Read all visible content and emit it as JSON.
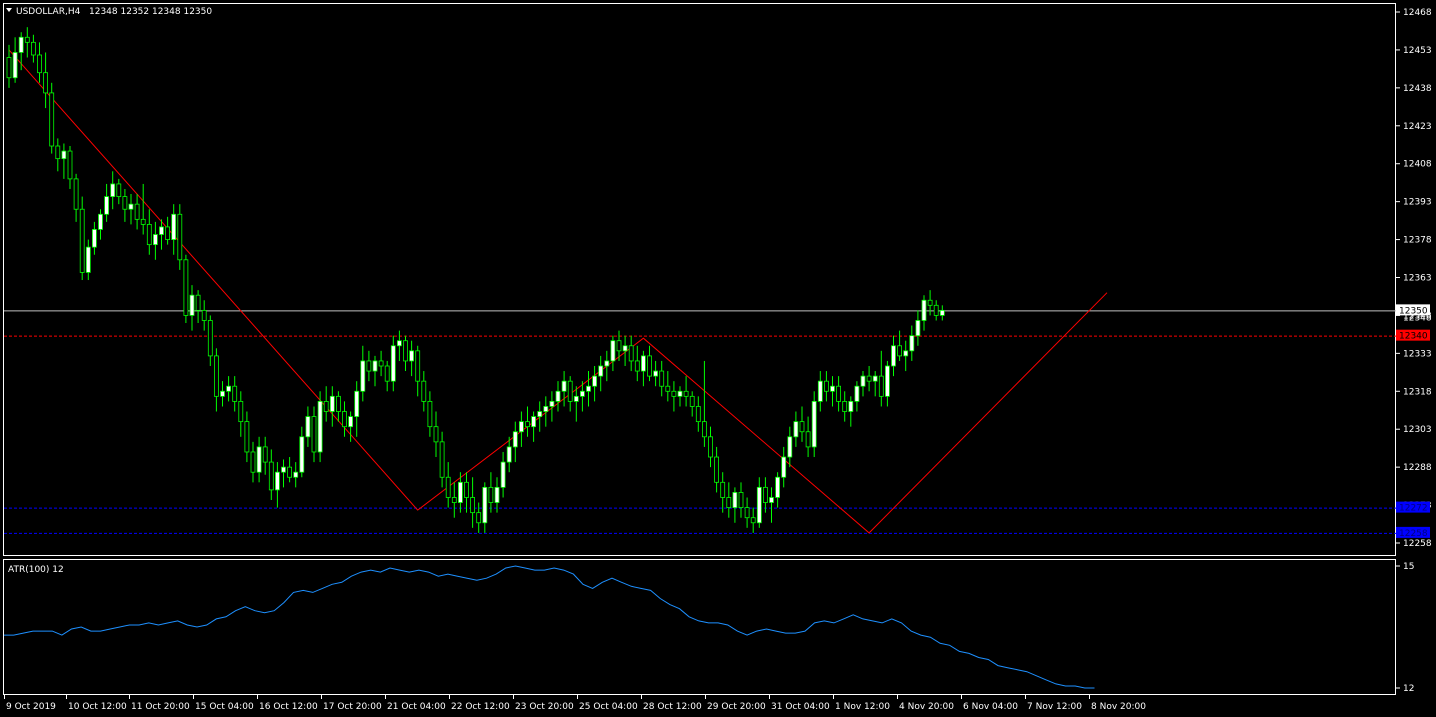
{
  "chart_header": {
    "symbol_timeframe": "USDOLLAR,H4",
    "ohlc": "12348 12352 12348 12350"
  },
  "indicator_header": {
    "label": "ATR(100) 12"
  },
  "colors": {
    "background": "#000000",
    "frame": "#ffffff",
    "bull_body": "#ffffff",
    "bear_body": "#000000",
    "wick": "#00ff00",
    "zigzag": "#ff0000",
    "atr_line": "#1e90ff",
    "bid_line": "#c0c0c0",
    "level_red": "#ff0000",
    "level_blue": "#0000ff"
  },
  "chart_data": {
    "type": "candlestick",
    "title": "USDOLLAR,H4",
    "price_axis_ticks": [
      "12468",
      "12453",
      "12438",
      "12423",
      "12408",
      "12393",
      "12378",
      "12363",
      "12348",
      "12333",
      "12318",
      "12303",
      "12288",
      "12273",
      "12258"
    ],
    "time_axis_ticks": [
      "9 Oct 2019",
      "10 Oct 12:00",
      "11 Oct 20:00",
      "15 Oct 04:00",
      "16 Oct 12:00",
      "17 Oct 20:00",
      "21 Oct 04:00",
      "22 Oct 12:00",
      "23 Oct 20:00",
      "25 Oct 04:00",
      "28 Oct 12:00",
      "29 Oct 20:00",
      "31 Oct 04:00",
      "1 Nov 12:00",
      "4 Nov 20:00",
      "6 Nov 04:00",
      "7 Nov 12:00",
      "8 Nov 20:00"
    ],
    "ylim": [
      12256,
      12470
    ],
    "current_price": 12350,
    "price_labels": {
      "current": "12350",
      "behind_current": "12348",
      "red_level": "12340",
      "blue_upper": "12272",
      "blue_lower": "12258"
    },
    "levels": [
      {
        "value": 12350,
        "style": "solid",
        "color": "#c0c0c0"
      },
      {
        "value": 12340,
        "style": "dashed",
        "color": "#ff0000"
      },
      {
        "value": 12272,
        "style": "dashed",
        "color": "#0000ff"
      },
      {
        "value": 12262,
        "style": "dashed",
        "color": "#0000ff"
      }
    ],
    "zigzag": [
      {
        "bar": 0,
        "price": 12453
      },
      {
        "bar": 67,
        "price": 12271
      },
      {
        "bar": 104,
        "price": 12339
      },
      {
        "bar": 141,
        "price": 12262
      },
      {
        "bar": 180,
        "price": 12357
      }
    ],
    "candles": [
      [
        12450,
        12455,
        12438,
        12442
      ],
      [
        12442,
        12458,
        12440,
        12452
      ],
      [
        12452,
        12460,
        12445,
        12458
      ],
      [
        12458,
        12462,
        12450,
        12456
      ],
      [
        12456,
        12459,
        12448,
        12451
      ],
      [
        12451,
        12456,
        12440,
        12444
      ],
      [
        12444,
        12452,
        12430,
        12436
      ],
      [
        12436,
        12440,
        12412,
        12415
      ],
      [
        12415,
        12418,
        12405,
        12410
      ],
      [
        12410,
        12416,
        12402,
        12413
      ],
      [
        12413,
        12415,
        12398,
        12402
      ],
      [
        12402,
        12404,
        12385,
        12390
      ],
      [
        12390,
        12395,
        12362,
        12365
      ],
      [
        12365,
        12378,
        12362,
        12375
      ],
      [
        12375,
        12385,
        12372,
        12382
      ],
      [
        12382,
        12390,
        12378,
        12388
      ],
      [
        12388,
        12400,
        12385,
        12395
      ],
      [
        12395,
        12405,
        12390,
        12400
      ],
      [
        12400,
        12402,
        12392,
        12395
      ],
      [
        12395,
        12398,
        12385,
        12390
      ],
      [
        12390,
        12396,
        12384,
        12392
      ],
      [
        12392,
        12396,
        12382,
        12386
      ],
      [
        12386,
        12400,
        12380,
        12384
      ],
      [
        12384,
        12390,
        12372,
        12376
      ],
      [
        12376,
        12385,
        12370,
        12380
      ],
      [
        12380,
        12386,
        12374,
        12383
      ],
      [
        12383,
        12387,
        12376,
        12378
      ],
      [
        12378,
        12392,
        12372,
        12388
      ],
      [
        12388,
        12392,
        12366,
        12370
      ],
      [
        12370,
        12372,
        12345,
        12348
      ],
      [
        12348,
        12360,
        12342,
        12356
      ],
      [
        12356,
        12358,
        12345,
        12350
      ],
      [
        12350,
        12354,
        12342,
        12346
      ],
      [
        12346,
        12348,
        12328,
        12332
      ],
      [
        12332,
        12335,
        12310,
        12316
      ],
      [
        12316,
        12322,
        12312,
        12318
      ],
      [
        12318,
        12324,
        12314,
        12320
      ],
      [
        12320,
        12324,
        12310,
        12314
      ],
      [
        12314,
        12318,
        12300,
        12306
      ],
      [
        12306,
        12310,
        12290,
        12294
      ],
      [
        12294,
        12298,
        12282,
        12286
      ],
      [
        12286,
        12300,
        12282,
        12296
      ],
      [
        12296,
        12300,
        12285,
        12290
      ],
      [
        12290,
        12295,
        12275,
        12279
      ],
      [
        12279,
        12290,
        12272,
        12286
      ],
      [
        12286,
        12291,
        12280,
        12288
      ],
      [
        12288,
        12292,
        12282,
        12284
      ],
      [
        12284,
        12290,
        12280,
        12286
      ],
      [
        12286,
        12304,
        12284,
        12300
      ],
      [
        12300,
        12312,
        12296,
        12308
      ],
      [
        12308,
        12312,
        12290,
        12294
      ],
      [
        12294,
        12318,
        12290,
        12314
      ],
      [
        12314,
        12320,
        12306,
        12310
      ],
      [
        12310,
        12320,
        12304,
        12316
      ],
      [
        12316,
        12318,
        12306,
        12310
      ],
      [
        12310,
        12314,
        12300,
        12304
      ],
      [
        12304,
        12310,
        12298,
        12308
      ],
      [
        12308,
        12322,
        12300,
        12318
      ],
      [
        12318,
        12336,
        12314,
        12330
      ],
      [
        12330,
        12334,
        12322,
        12326
      ],
      [
        12326,
        12332,
        12320,
        12330
      ],
      [
        12330,
        12334,
        12324,
        12328
      ],
      [
        12328,
        12330,
        12318,
        12322
      ],
      [
        12322,
        12340,
        12318,
        12336
      ],
      [
        12336,
        12342,
        12330,
        12338
      ],
      [
        12338,
        12340,
        12326,
        12330
      ],
      [
        12330,
        12338,
        12324,
        12334
      ],
      [
        12334,
        12336,
        12316,
        12322
      ],
      [
        12322,
        12326,
        12310,
        12314
      ],
      [
        12314,
        12318,
        12300,
        12304
      ],
      [
        12304,
        12310,
        12292,
        12298
      ],
      [
        12298,
        12302,
        12280,
        12284
      ],
      [
        12284,
        12290,
        12272,
        12276
      ],
      [
        12276,
        12282,
        12268,
        12274
      ],
      [
        12274,
        12286,
        12270,
        12282
      ],
      [
        12282,
        12286,
        12270,
        12276
      ],
      [
        12276,
        12284,
        12264,
        12270
      ],
      [
        12270,
        12274,
        12262,
        12266
      ],
      [
        12266,
        12282,
        12262,
        12280
      ],
      [
        12280,
        12286,
        12270,
        12274
      ],
      [
        12274,
        12284,
        12270,
        12280
      ],
      [
        12280,
        12294,
        12276,
        12290
      ],
      [
        12290,
        12300,
        12286,
        12296
      ],
      [
        12296,
        12306,
        12290,
        12302
      ],
      [
        12302,
        12310,
        12296,
        12306
      ],
      [
        12306,
        12312,
        12300,
        12304
      ],
      [
        12304,
        12310,
        12298,
        12308
      ],
      [
        12308,
        12314,
        12302,
        12310
      ],
      [
        12310,
        12316,
        12304,
        12312
      ],
      [
        12312,
        12318,
        12306,
        12314
      ],
      [
        12314,
        12322,
        12310,
        12318
      ],
      [
        12318,
        12326,
        12312,
        12322
      ],
      [
        12322,
        12324,
        12310,
        12314
      ],
      [
        12314,
        12320,
        12306,
        12316
      ],
      [
        12316,
        12322,
        12310,
        12318
      ],
      [
        12318,
        12326,
        12312,
        12320
      ],
      [
        12320,
        12328,
        12314,
        12324
      ],
      [
        12324,
        12332,
        12318,
        12328
      ],
      [
        12328,
        12334,
        12322,
        12330
      ],
      [
        12330,
        12340,
        12326,
        12338
      ],
      [
        12338,
        12342,
        12330,
        12334
      ],
      [
        12334,
        12340,
        12328,
        12336
      ],
      [
        12336,
        12340,
        12326,
        12330
      ],
      [
        12330,
        12336,
        12322,
        12326
      ],
      [
        12326,
        12334,
        12320,
        12332
      ],
      [
        12332,
        12336,
        12322,
        12324
      ],
      [
        12324,
        12330,
        12320,
        12326
      ],
      [
        12326,
        12330,
        12316,
        12320
      ],
      [
        12320,
        12326,
        12314,
        12318
      ],
      [
        12318,
        12322,
        12310,
        12316
      ],
      [
        12316,
        12320,
        12312,
        12318
      ],
      [
        12318,
        12324,
        12312,
        12316
      ],
      [
        12316,
        12318,
        12308,
        12312
      ],
      [
        12312,
        12316,
        12302,
        12306
      ],
      [
        12306,
        12330,
        12296,
        12300
      ],
      [
        12300,
        12304,
        12288,
        12292
      ],
      [
        12292,
        12296,
        12278,
        12282
      ],
      [
        12282,
        12286,
        12270,
        12276
      ],
      [
        12276,
        12282,
        12268,
        12272
      ],
      [
        12272,
        12280,
        12266,
        12278
      ],
      [
        12278,
        12282,
        12268,
        12272
      ],
      [
        12272,
        12276,
        12264,
        12268
      ],
      [
        12268,
        12272,
        12262,
        12266
      ],
      [
        12266,
        12284,
        12264,
        12280
      ],
      [
        12280,
        12284,
        12270,
        12274
      ],
      [
        12274,
        12280,
        12266,
        12276
      ],
      [
        12276,
        12286,
        12272,
        12284
      ],
      [
        12284,
        12296,
        12280,
        12292
      ],
      [
        12292,
        12304,
        12288,
        12300
      ],
      [
        12300,
        12310,
        12296,
        12306
      ],
      [
        12306,
        12312,
        12298,
        12302
      ],
      [
        12302,
        12308,
        12292,
        12296
      ],
      [
        12296,
        12318,
        12292,
        12314
      ],
      [
        12314,
        12326,
        12310,
        12322
      ],
      [
        12322,
        12326,
        12314,
        12318
      ],
      [
        12318,
        12324,
        12312,
        12320
      ],
      [
        12320,
        12324,
        12310,
        12314
      ],
      [
        12314,
        12318,
        12306,
        12310
      ],
      [
        12310,
        12316,
        12304,
        12314
      ],
      [
        12314,
        12322,
        12310,
        12320
      ],
      [
        12320,
        12326,
        12316,
        12324
      ],
      [
        12324,
        12328,
        12318,
        12322
      ],
      [
        12322,
        12326,
        12316,
        12324
      ],
      [
        12324,
        12334,
        12312,
        12316
      ],
      [
        12316,
        12330,
        12312,
        12328
      ],
      [
        12328,
        12340,
        12324,
        12336
      ],
      [
        12336,
        12342,
        12330,
        12332
      ],
      [
        12332,
        12338,
        12326,
        12334
      ],
      [
        12334,
        12344,
        12330,
        12340
      ],
      [
        12340,
        12350,
        12336,
        12346
      ],
      [
        12346,
        12356,
        12342,
        12354
      ],
      [
        12354,
        12358,
        12348,
        12352
      ],
      [
        12352,
        12354,
        12346,
        12348
      ],
      [
        12348,
        12352,
        12346,
        12350
      ]
    ],
    "atr": {
      "label": "ATR(100) 12",
      "axis_ticks": [
        "15",
        "12"
      ],
      "ylim": [
        11.9,
        15.1
      ],
      "values": [
        13.3,
        13.3,
        13.35,
        13.4,
        13.4,
        13.4,
        13.3,
        13.45,
        13.5,
        13.4,
        13.4,
        13.45,
        13.5,
        13.55,
        13.55,
        13.6,
        13.55,
        13.6,
        13.65,
        13.55,
        13.5,
        13.55,
        13.7,
        13.75,
        13.9,
        14.0,
        13.9,
        13.85,
        13.9,
        14.1,
        14.35,
        14.4,
        14.35,
        14.45,
        14.55,
        14.6,
        14.75,
        14.85,
        14.9,
        14.85,
        14.95,
        14.9,
        14.85,
        14.9,
        14.85,
        14.75,
        14.8,
        14.75,
        14.7,
        14.65,
        14.7,
        14.8,
        14.95,
        15.0,
        14.95,
        14.9,
        14.9,
        14.95,
        14.9,
        14.8,
        14.55,
        14.45,
        14.6,
        14.7,
        14.6,
        14.5,
        14.45,
        14.4,
        14.2,
        14.05,
        13.95,
        13.75,
        13.65,
        13.6,
        13.6,
        13.55,
        13.4,
        13.3,
        13.4,
        13.45,
        13.4,
        13.35,
        13.35,
        13.4,
        13.6,
        13.65,
        13.6,
        13.7,
        13.8,
        13.7,
        13.65,
        13.6,
        13.7,
        13.6,
        13.4,
        13.3,
        13.25,
        13.1,
        13.05,
        12.9,
        12.85,
        12.75,
        12.7,
        12.55,
        12.5,
        12.45,
        12.4,
        12.3,
        12.2,
        12.1,
        12.05,
        12.05,
        12.0,
        12.0
      ]
    }
  }
}
